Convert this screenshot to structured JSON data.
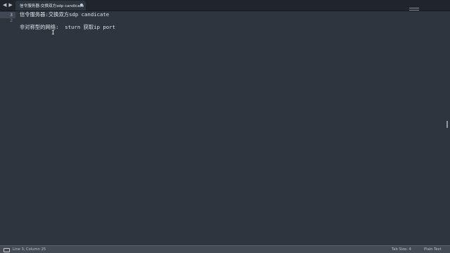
{
  "window": {
    "tab_title": "信令服务器:交换双方sdp candicate",
    "nav_back": "◀",
    "nav_forward": "▶"
  },
  "editor": {
    "line_numbers": [
      "1",
      "2",
      "3"
    ],
    "lines": [
      "信令服务器:交换双方sdp candicate",
      "",
      "非对称型的网络:  sturn 获取ip port"
    ],
    "cursor_glyph": "I"
  },
  "statusbar": {
    "position": "Line 3, Column 25",
    "tab_size": "Tab Size: 4",
    "syntax": "Plain Text"
  },
  "colors": {
    "background": "#2d353f",
    "tab_bar": "#1f252b",
    "status_bar": "#444b55",
    "text": "#dde3e8"
  }
}
